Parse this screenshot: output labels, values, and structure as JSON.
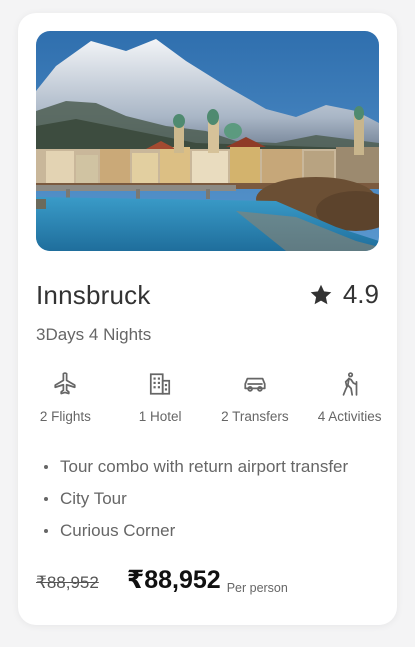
{
  "card": {
    "destination": "Innsbruck",
    "rating": "4.9",
    "duration": "3Days 4 Nights",
    "features": [
      {
        "label": "2 Flights",
        "icon": "airplane-icon"
      },
      {
        "label": "1 Hotel",
        "icon": "hotel-icon"
      },
      {
        "label": "2 Transfers",
        "icon": "car-icon"
      },
      {
        "label": "4 Activities",
        "icon": "hiking-icon"
      }
    ],
    "highlights": [
      "Tour combo with return airport transfer",
      "City Tour",
      "Curious Corner"
    ],
    "original_price": "₹88,952",
    "price": "₹88,952",
    "price_unit": "Per person"
  },
  "colors": {
    "text_primary": "#333333",
    "text_secondary": "#666666",
    "price": "#111111",
    "card_bg": "#ffffff",
    "page_bg": "#f4f4f5"
  }
}
